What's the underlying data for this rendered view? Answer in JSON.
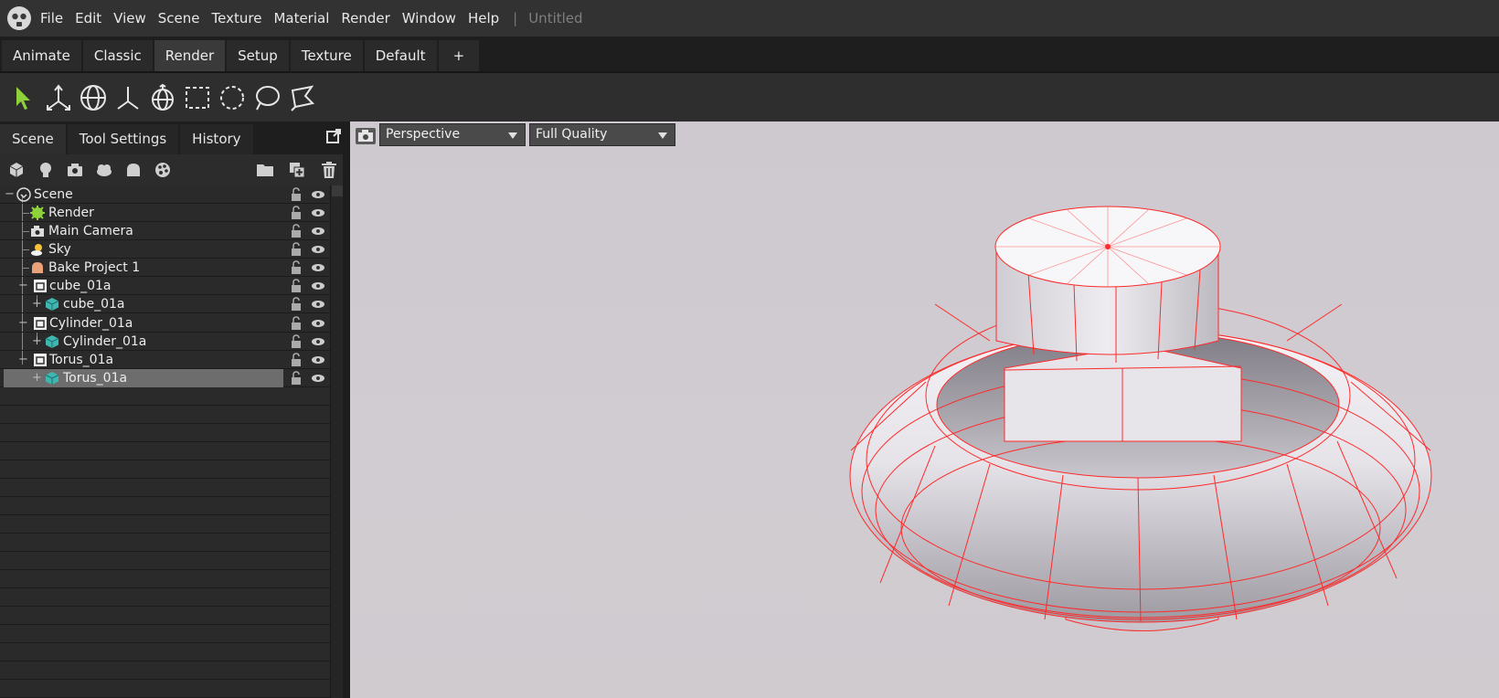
{
  "menu": {
    "items": [
      "File",
      "Edit",
      "View",
      "Scene",
      "Texture",
      "Material",
      "Render",
      "Window",
      "Help"
    ],
    "separator": "|",
    "document_title": "Untitled"
  },
  "workspace_tabs": [
    "Animate",
    "Classic",
    "Render",
    "Setup",
    "Texture",
    "Default",
    "+"
  ],
  "active_workspace": "Render",
  "tools": [
    "select-arrow-icon",
    "move-axis-icon",
    "rotate-sphere-icon",
    "scale-axis-icon",
    "cage-sphere-icon",
    "rect-select-icon",
    "circle-select-icon",
    "lasso-select-icon",
    "polygon-select-icon"
  ],
  "panel_tabs": [
    "Scene",
    "Tool Settings",
    "History"
  ],
  "active_panel_tab": "Scene",
  "scene_toolbar_icons": [
    "add-cube-icon",
    "add-light-icon",
    "add-camera-icon",
    "add-sky-icon",
    "add-bake-icon",
    "add-material-icon",
    "folder-icon",
    "duplicate-icon",
    "trash-icon"
  ],
  "scene_tree": [
    {
      "label": "Scene",
      "icon": "scene-root-icon"
    },
    {
      "label": "Render",
      "icon": "render-gear-icon"
    },
    {
      "label": "Main Camera",
      "icon": "camera-icon"
    },
    {
      "label": "Sky",
      "icon": "sky-icon"
    },
    {
      "label": "Bake Project 1",
      "icon": "bake-icon"
    },
    {
      "label": "cube_01a",
      "icon": "group-icon"
    },
    {
      "label": "cube_01a",
      "icon": "mesh-icon"
    },
    {
      "label": "Cylinder_01a",
      "icon": "group-icon"
    },
    {
      "label": "Cylinder_01a",
      "icon": "mesh-icon"
    },
    {
      "label": "Torus_01a",
      "icon": "group-icon"
    },
    {
      "label": "Torus_01a",
      "icon": "mesh-icon",
      "selected": true
    }
  ],
  "viewport": {
    "camera": "Perspective",
    "quality": "Full Quality"
  },
  "colors": {
    "wireframe": "#ff2a2a",
    "selection": "#6d6d6d",
    "accent_green": "#8fd13a"
  }
}
